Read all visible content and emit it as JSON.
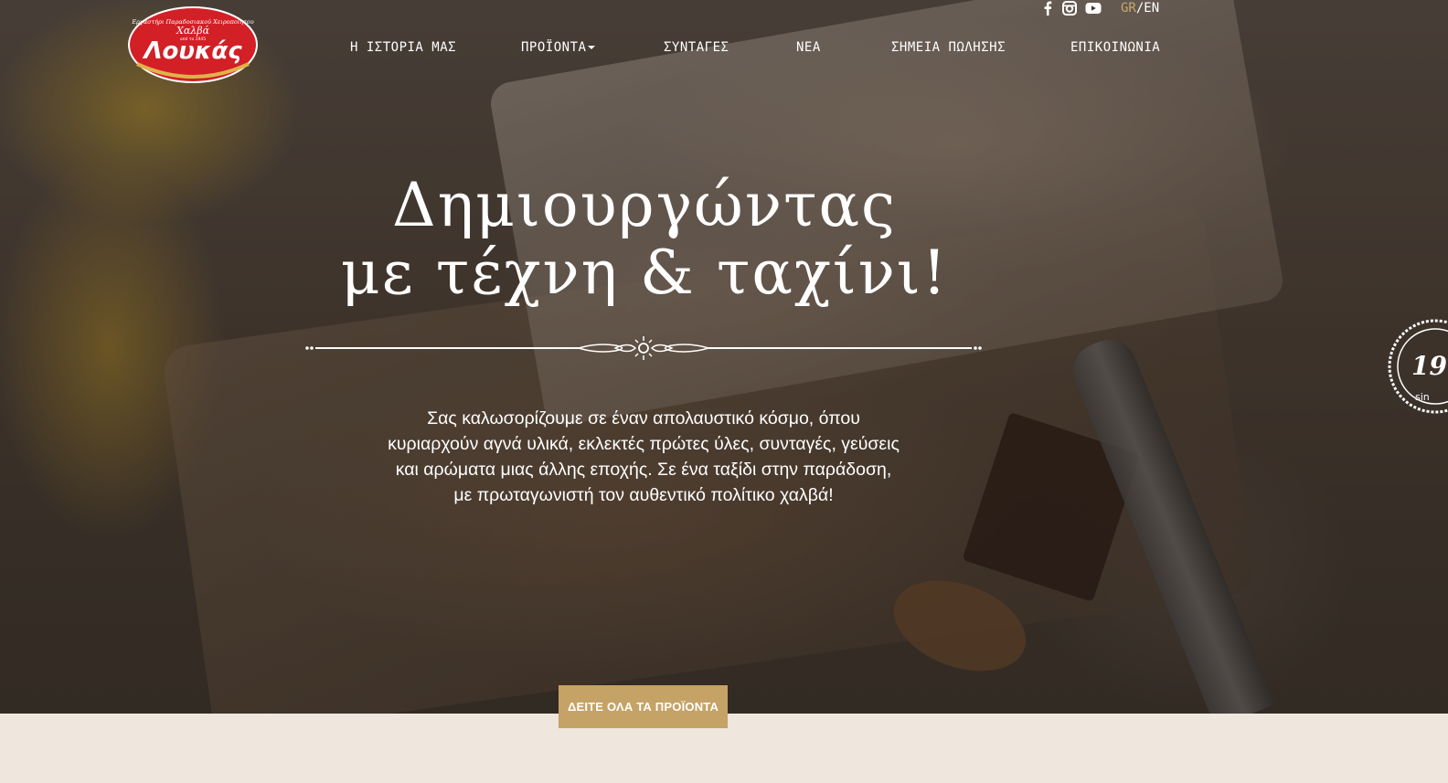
{
  "brand": {
    "logo_top_text": "Εργαστήρι Παραδοσιακού Χειροποίητου",
    "logo_sub_text": "Χαλβά",
    "logo_since": "από το 1945",
    "logo_name": "Λουκάς",
    "colors": {
      "logo_red": "#d31f26",
      "logo_gold": "#e1b24a",
      "accent": "#c5a266"
    }
  },
  "nav": {
    "items": [
      {
        "label": "Η ΙΣΤΟΡΙΑ ΜΑΣ"
      },
      {
        "label": "ΠΡΟΪΟΝΤΑ",
        "has_dropdown": true
      },
      {
        "label": "ΣΥΝΤΑΓΕΣ"
      },
      {
        "label": "ΝΕΑ"
      },
      {
        "label": "ΣΗΜΕΙΑ ΠΩΛΗΣΗΣ"
      },
      {
        "label": "ΕΠΙΚΟΙΝΩΝΙΑ"
      }
    ],
    "social_icons": [
      "facebook-icon",
      "instagram-icon",
      "youtube-icon"
    ],
    "lang": {
      "active": "GR",
      "separator": "/",
      "other": "EN"
    }
  },
  "hero": {
    "title_line1": "Δημιουργώντας",
    "title_line2": "με τέχνη & ταχίνι!",
    "intro_lines": [
      "Σας καλωσορίζουμε σε έναν απολαυστικό κόσμο, όπου",
      "κυριαρχούν αγνά υλικά, εκλεκτές πρώτες ύλες, συνταγές, γεύσεις",
      "και αρώματα μιας άλλης εποχής. Σε ένα ταξίδι στην παράδοση,",
      "με πρωταγωνιστή τον αυθεντικό πολίτικο χαλβά!"
    ],
    "cta_label": "ΔΕΙΤΕ ΟΛΑ ΤΑ ΠΡΟΪΟΝΤΑ",
    "seal_text_big": "19",
    "seal_text_small": "sin"
  }
}
